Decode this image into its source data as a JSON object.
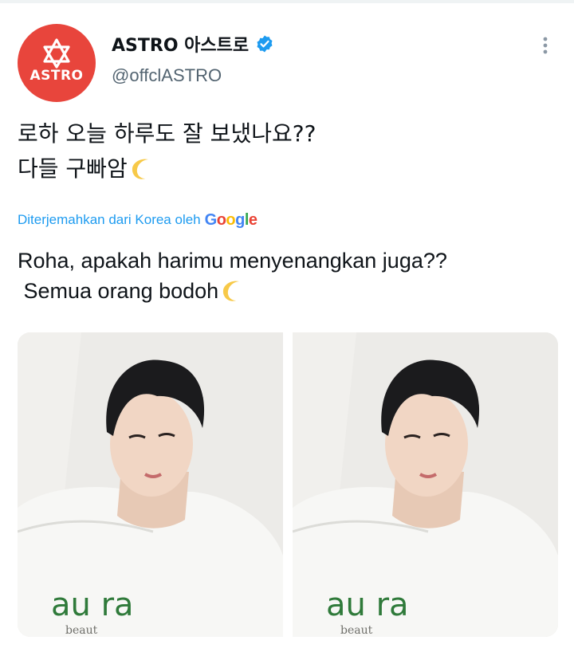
{
  "account": {
    "display_name": "ASTRO 아스트로",
    "handle": "@offclASTRO",
    "avatar_text": "ASTRO",
    "verified": true
  },
  "tweet": {
    "original_line1": "로하 오늘 하루도 잘 보냈나요??",
    "original_line2": "다들 구빠암",
    "translation_label": "Diterjemahkan dari Korea oleh",
    "translation_provider": "Google",
    "translated_line1": "Roha, apakah harimu menyenangkan juga??",
    "translated_line2": " Semua orang bodoh"
  },
  "media": {
    "count": 2,
    "shirt_text": "au ra",
    "shirt_subtext": "beaut"
  },
  "icons": {
    "verified": "verified-badge-icon",
    "more": "more-options-icon",
    "moon": "crescent-moon-emoji"
  },
  "colors": {
    "brand_red": "#e8453c",
    "link_blue": "#1d9bf0",
    "handle_gray": "#536471",
    "text": "#0f1419"
  }
}
